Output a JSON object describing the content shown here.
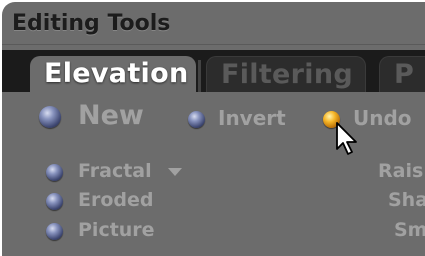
{
  "header": {
    "title": "Editing Tools"
  },
  "tabs": [
    {
      "label": "Elevation",
      "active": true
    },
    {
      "label": "Filtering",
      "active": false
    },
    {
      "label": "P",
      "active": false
    }
  ],
  "actions": {
    "new": {
      "label": "New",
      "selected": false
    },
    "invert": {
      "label": "Invert",
      "selected": false
    },
    "undo": {
      "label": "Undo",
      "selected": true
    }
  },
  "sources": [
    {
      "label": "Fractal",
      "has_dropdown": true
    },
    {
      "label": "Eroded"
    },
    {
      "label": "Picture"
    }
  ],
  "right_column": [
    "Rais",
    "Sha",
    "Sm"
  ],
  "colors": {
    "panel": "#6c6c6c",
    "tab_strip": "#1b1b1b",
    "label_text": "#a1a1a1",
    "radio_off": "#5a6494",
    "radio_on": "#f1a20c"
  },
  "icons": {
    "dropdown": "chevron-down-icon",
    "pointer": "mouse-cursor-icon"
  }
}
